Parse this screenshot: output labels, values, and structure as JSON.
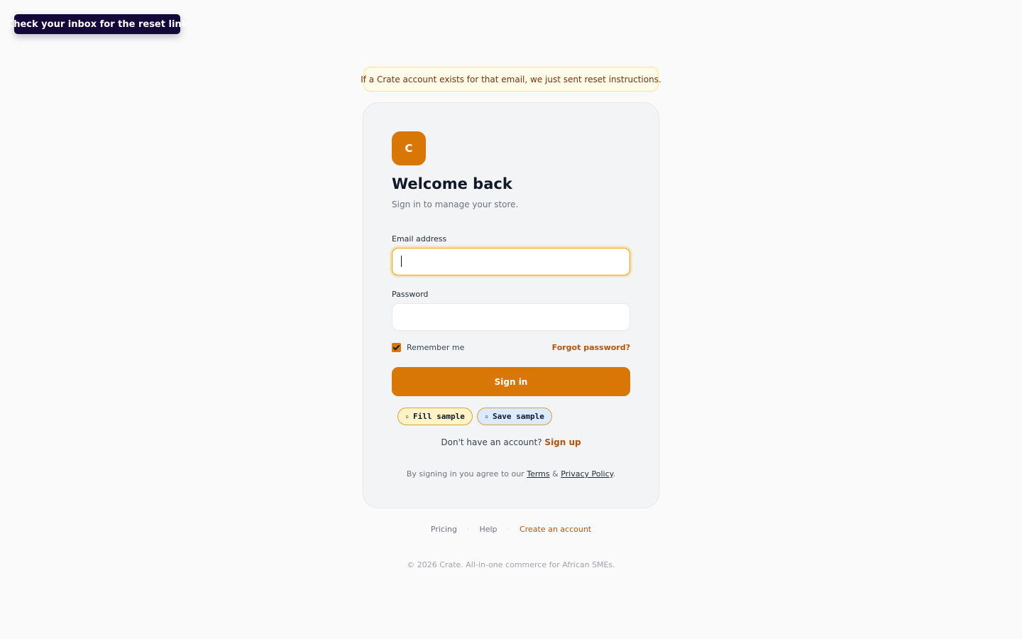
{
  "toast": {
    "text": "Check your inbox for the reset link"
  },
  "notice": {
    "text": "If a Crate account exists for that email, we just sent reset instructions."
  },
  "card": {
    "logo_letter": "C",
    "title": "Welcome back",
    "subtitle": "Sign in to manage your store.",
    "email": {
      "label": "Email address",
      "value": "",
      "placeholder": ""
    },
    "password": {
      "label": "Password",
      "value": "",
      "placeholder": ""
    },
    "remember_label": "Remember me",
    "remember_checked": true,
    "forgot_label": "Forgot password?",
    "signin_label": "Sign in",
    "chips": {
      "fill": {
        "icon": "▫",
        "label": "Fill sample"
      },
      "save": {
        "icon": "▫",
        "label": "Save sample"
      }
    },
    "signup": {
      "prompt": "Don't have an account?",
      "link": "Sign up"
    },
    "legal": {
      "prefix": "By signing in you agree to our",
      "terms": "Terms",
      "amp": "&",
      "privacy": "Privacy Policy",
      "suffix": "."
    }
  },
  "footer": {
    "links": {
      "pricing": "Pricing",
      "help": "Help",
      "create": "Create an account"
    },
    "separator": "·",
    "copyright": "© 2026 Crate. All-in-one commerce for African SMEs."
  },
  "colors": {
    "accent": "#d97706",
    "accent_text": "#b45309",
    "toast_bg": "#14073a",
    "notice_bg": "#fefce8"
  }
}
